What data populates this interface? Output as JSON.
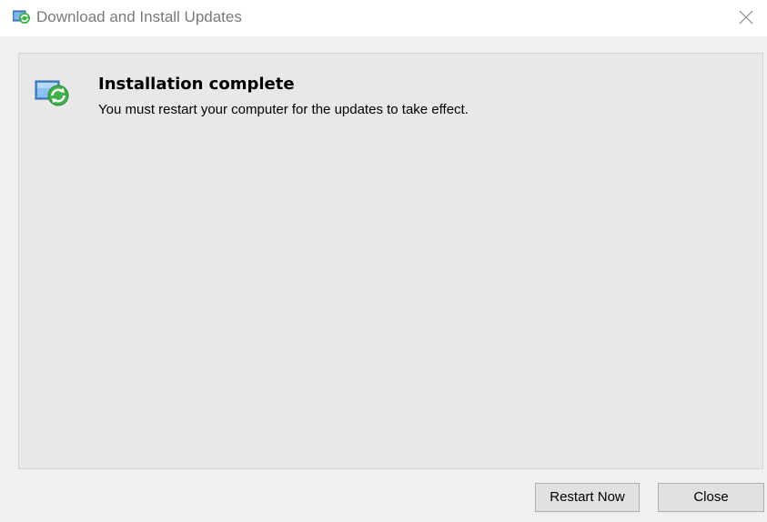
{
  "window": {
    "title": "Download and Install Updates",
    "icon": "windows-update-icon"
  },
  "message": {
    "heading": "Installation complete",
    "body": "You must restart your computer for the updates to take effect."
  },
  "buttons": {
    "restart_label": "Restart Now",
    "close_label": "Close"
  },
  "colors": {
    "update_arrow_green": "#3fb04a",
    "monitor_blue": "#4a8fd6"
  }
}
